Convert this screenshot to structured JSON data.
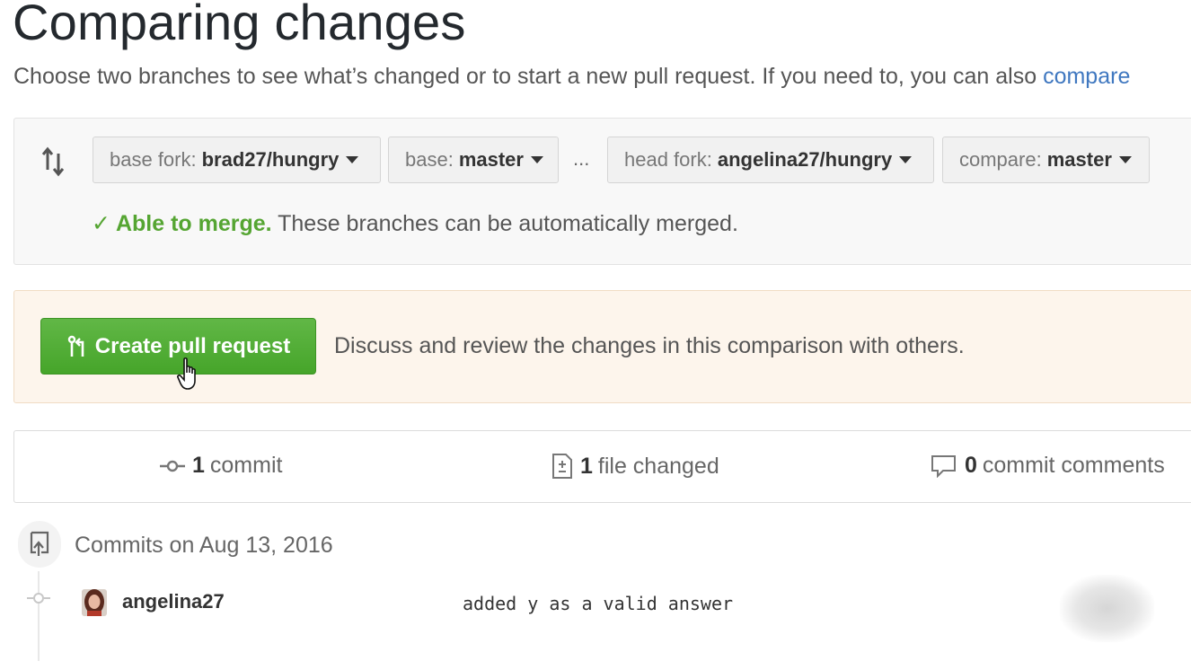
{
  "header": {
    "title": "Comparing changes",
    "subtitle_text": "Choose two branches to see what’s changed or to start a new pull request. If you need to, you can also ",
    "subtitle_link": "compare"
  },
  "compare": {
    "base_fork_label": "base fork:",
    "base_fork_value": "brad27/hungry",
    "base_label": "base:",
    "base_value": "master",
    "separator": "...",
    "head_fork_label": "head fork:",
    "head_fork_value": "angelina27/hungry",
    "compare_label": "compare:",
    "compare_value": "master",
    "merge_status": "Able to merge.",
    "merge_detail": "These branches can be automatically merged."
  },
  "pull_request": {
    "button_label": "Create pull request",
    "description": "Discuss and review the changes in this comparison with others."
  },
  "stats": {
    "commits_count": "1",
    "commits_label": "commit",
    "files_count": "1",
    "files_label": "file changed",
    "comments_count": "0",
    "comments_label": "commit comments"
  },
  "commits": {
    "date_heading": "Commits on Aug 13, 2016",
    "items": [
      {
        "author": "angelina27",
        "message": "added y as a valid answer"
      }
    ]
  },
  "colors": {
    "accent_green": "#55a532",
    "link_blue": "#4078c0",
    "pr_box_bg": "#fdf5ec"
  },
  "icons": [
    "compare-arrows-icon",
    "caret-down-icon",
    "check-icon",
    "git-pull-request-icon",
    "pointer-cursor-icon",
    "git-commit-icon",
    "file-diff-icon",
    "comment-icon",
    "repo-push-icon"
  ]
}
